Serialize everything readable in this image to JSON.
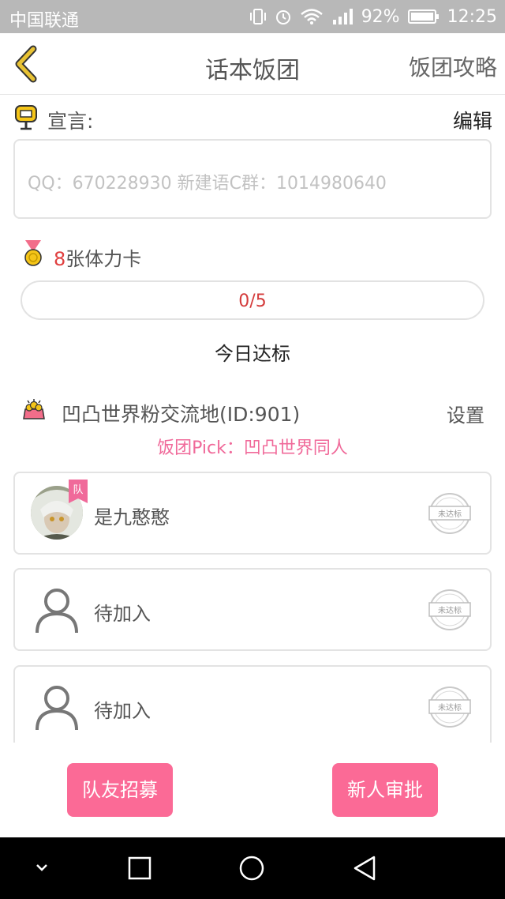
{
  "status_bar": {
    "carrier": "中国联通",
    "battery": "92%",
    "time": "12:25",
    "icons": [
      "vibrate-icon",
      "alarm-icon",
      "wifi-icon",
      "signal-icon",
      "battery-icon"
    ]
  },
  "header": {
    "title": "话本饭团",
    "guide_link": "饭团攻略",
    "back_icon": "back-chevron-icon"
  },
  "declaration": {
    "label": "宣言:",
    "edit_label": "编辑",
    "text": "QQ：670228930 新建语C群：1014980640"
  },
  "stamina": {
    "count": "8",
    "suffix": "张体力卡",
    "progress_text": "0/5",
    "progress_fraction": 0,
    "daily_label": "今日达标"
  },
  "group": {
    "name": "凹凸世界粉交流地(ID:901)",
    "settings_label": "设置",
    "pick": "饭团Pick：凹凸世界同人"
  },
  "members": [
    {
      "name": "是九憨憨",
      "badge": "队",
      "status": "未达标",
      "has_avatar": true
    },
    {
      "name": "待加入",
      "status": "未达标",
      "has_avatar": false
    },
    {
      "name": "待加入",
      "status": "未达标",
      "has_avatar": false
    }
  ],
  "buttons": {
    "recruit": "队友招募",
    "approve": "新人审批"
  },
  "colors": {
    "accent_pink": "#fb6a96",
    "pick_pink": "#f06a9a",
    "progress_red": "#d43b3b",
    "back_yellow": "#e8c233"
  }
}
